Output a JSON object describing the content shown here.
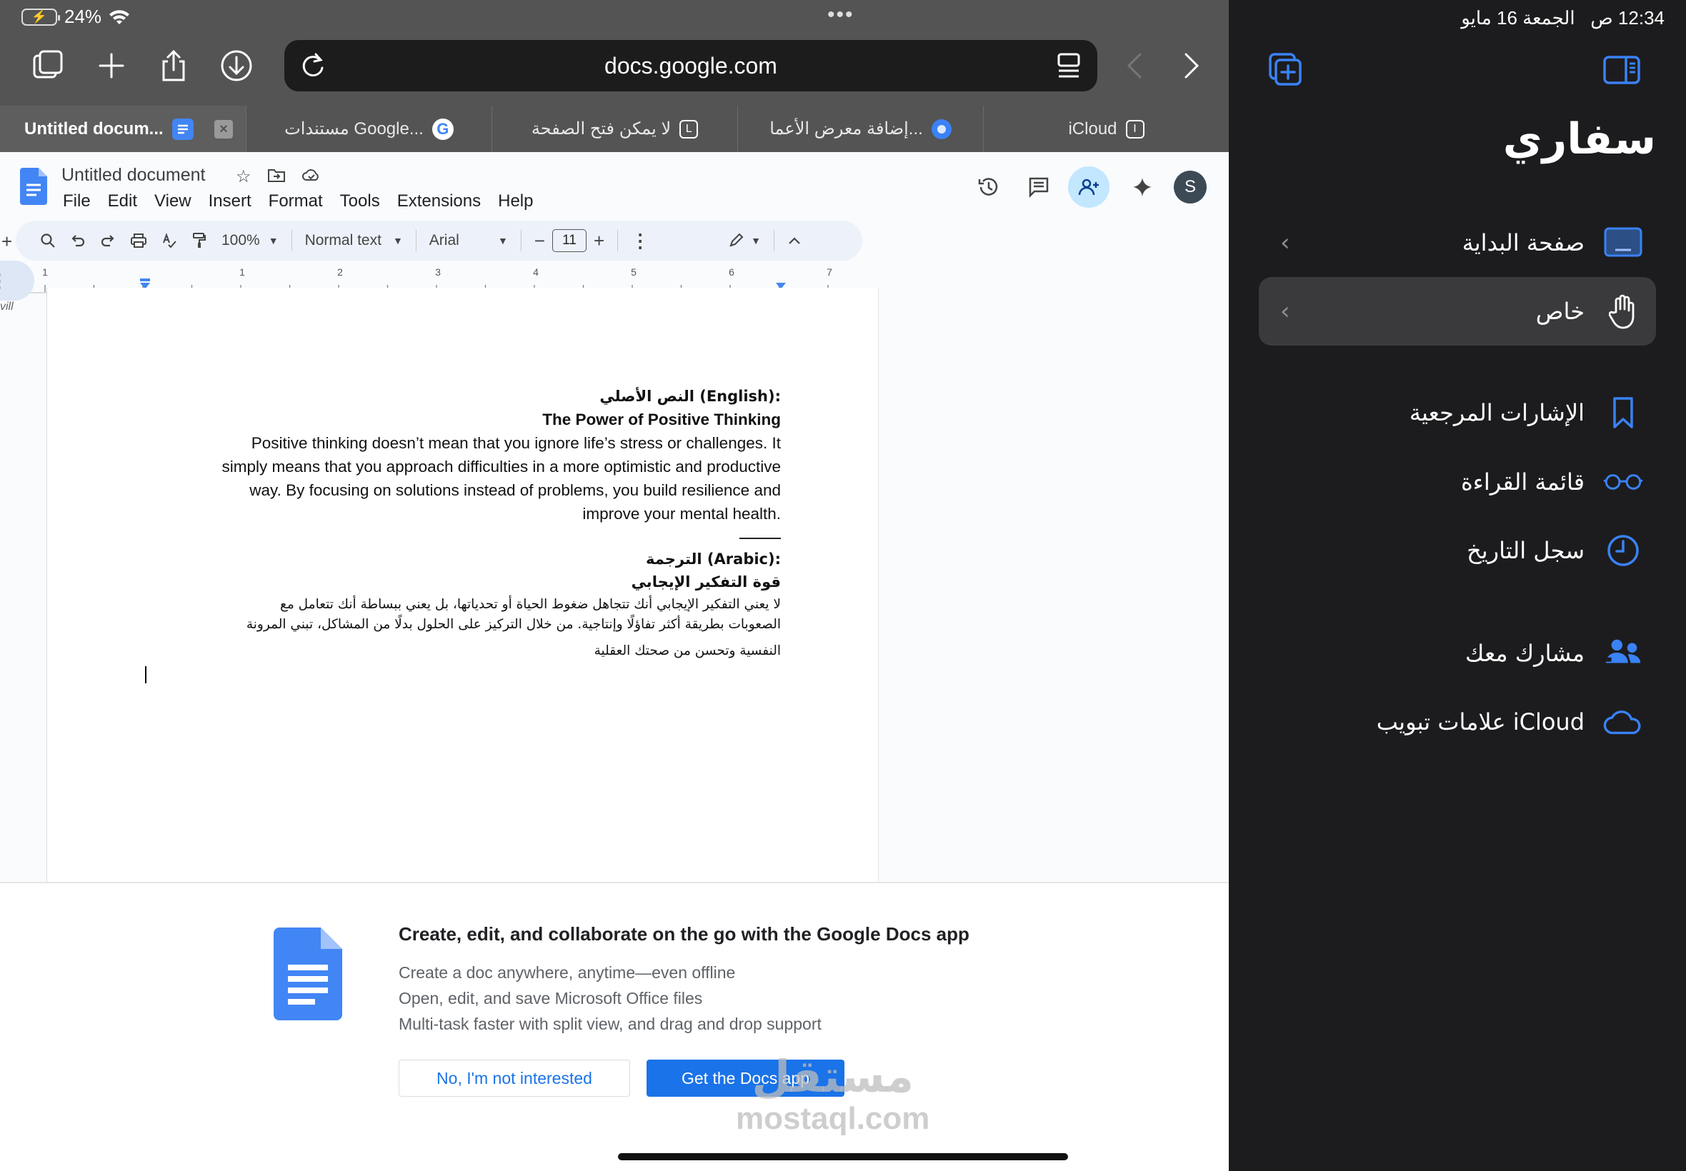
{
  "status": {
    "battery": "24%",
    "time": "12:34 ص",
    "date": "الجمعة 16 مايو"
  },
  "address_bar": {
    "url": "docs.google.com"
  },
  "tabs": [
    {
      "label": "Untitled docum...",
      "active": true
    },
    {
      "label": "مستندات Google...",
      "favicon": "G"
    },
    {
      "label": "لا يمكن فتح الصفحة",
      "favicon": "L"
    },
    {
      "label": "إضافة معرض الأعما...",
      "favicon": "O"
    },
    {
      "label": "iCloud",
      "favicon": "I"
    }
  ],
  "docs": {
    "title": "Untitled document",
    "menu": [
      "File",
      "Edit",
      "View",
      "Insert",
      "Format",
      "Tools",
      "Extensions",
      "Help"
    ],
    "avatar": "S",
    "toolbar": {
      "zoom": "100%",
      "style": "Normal text",
      "font": "Arial",
      "font_size": "11"
    },
    "ruler_numbers": [
      "1",
      "1",
      "2",
      "3",
      "4",
      "5",
      "6",
      "7"
    ],
    "side_text": "vill",
    "content": {
      "heading_ar_original": "النص الأصلي (English):",
      "en_title": "The Power of Positive Thinking",
      "en_lines": [
        "Positive thinking doesn’t mean that you ignore life’s stress or challenges. It",
        "simply means that you approach difficulties in a more optimistic and productive",
        "way. By focusing on solutions instead of problems, you build resilience and",
        "improve your mental health."
      ],
      "heading_ar_translation": "الترجمة (Arabic):",
      "ar_title": "قوة التفكير الإيجابي",
      "ar_lines": [
        "لا يعني التفكير الإيجابي أنك تتجاهل ضغوط الحياة أو تحدياتها، بل يعني ببساطة أنك تتعامل مع",
        "الصعوبات بطريقة أكثر تفاؤلًا وإنتاجية. من خلال التركيز على الحلول بدلًا من المشاكل، تبني المرونة",
        "النفسية وتحسن من صحتك العقلية"
      ]
    }
  },
  "banner": {
    "title": "Create, edit, and collaborate on the go with the Google Docs app",
    "lines": [
      "Create a doc anywhere, anytime—even offline",
      "Open, edit, and save Microsoft Office files",
      "Multi-task faster with split view, and drag and drop support"
    ],
    "decline": "No, I'm not interested",
    "accept": "Get the Docs app"
  },
  "watermark": {
    "line1": "مستقل",
    "line2": "mostaql.com"
  },
  "sidebar": {
    "title": "سفاري",
    "items": [
      {
        "label": "صفحة البداية",
        "icon": "start-page-icon"
      },
      {
        "label": "خاص",
        "icon": "hand-icon"
      },
      {
        "label": "الإشارات المرجعية",
        "icon": "bookmark-icon"
      },
      {
        "label": "قائمة القراءة",
        "icon": "glasses-icon"
      },
      {
        "label": "سجل التاريخ",
        "icon": "clock-icon"
      },
      {
        "label": "مشارك معك",
        "icon": "people-icon"
      },
      {
        "label": "علامات تبويب iCloud",
        "icon": "cloud-icon"
      }
    ]
  },
  "colors": {
    "accent": "#1a73e8",
    "sidebar_accent": "#3a82f6",
    "chrome": "#545454",
    "sidebar_bg": "#1c1c1e"
  }
}
